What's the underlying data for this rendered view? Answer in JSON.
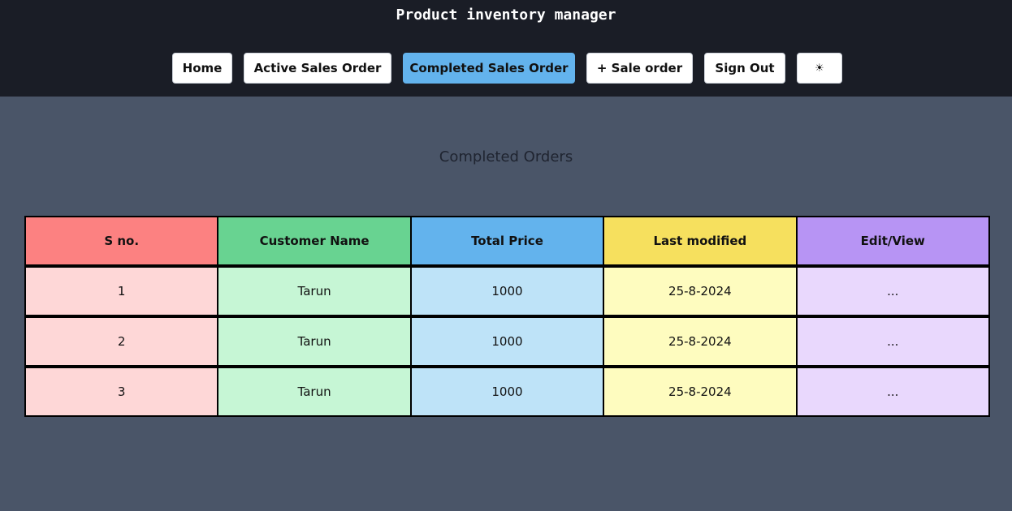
{
  "header": {
    "title": "Product inventory manager",
    "nav": [
      {
        "label": "Home",
        "active": false
      },
      {
        "label": "Active Sales Order",
        "active": false
      },
      {
        "label": "Completed Sales Order",
        "active": true
      },
      {
        "label": "+ Sale order",
        "active": false
      },
      {
        "label": "Sign Out",
        "active": false
      },
      {
        "label": "☀",
        "icon": "sun-icon",
        "active": false
      }
    ]
  },
  "main": {
    "section_title": "Completed Orders",
    "table": {
      "columns": [
        "S no.",
        "Customer Name",
        "Total Price",
        "Last modified",
        "Edit/View"
      ],
      "rows": [
        {
          "sno": "1",
          "customer": "Tarun",
          "price": "1000",
          "modified": "25-8-2024",
          "action": "..."
        },
        {
          "sno": "2",
          "customer": "Tarun",
          "price": "1000",
          "modified": "25-8-2024",
          "action": "..."
        },
        {
          "sno": "3",
          "customer": "Tarun",
          "price": "1000",
          "modified": "25-8-2024",
          "action": "..."
        }
      ]
    }
  },
  "colors": {
    "header_bg": "#1a1d26",
    "page_bg": "#4a5568",
    "active_nav": "#63b3ed"
  }
}
